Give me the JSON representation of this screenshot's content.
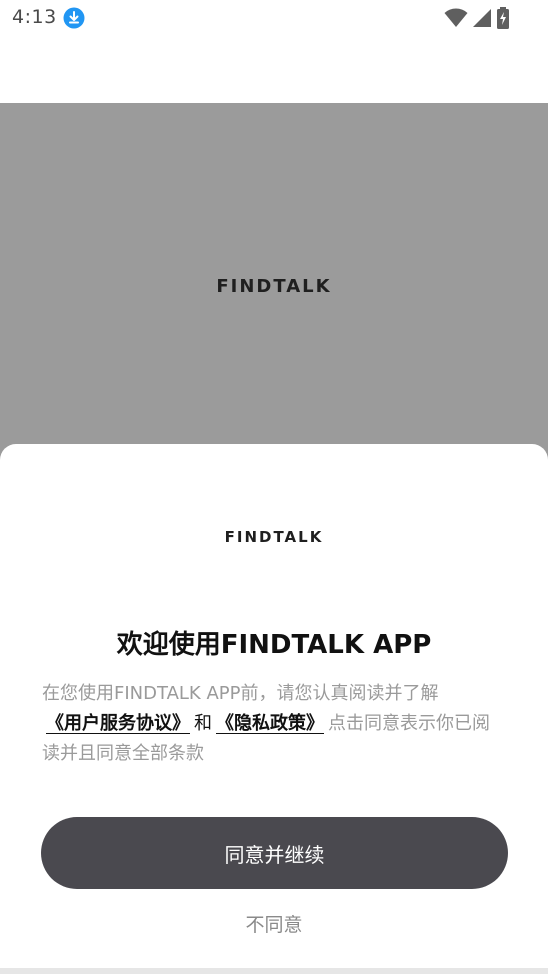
{
  "status_bar": {
    "time": "4:13",
    "download_icon": "download-circle-icon",
    "accent_color": "#2196f3"
  },
  "splash": {
    "logo_text": "FINDTALK",
    "background_color": "#9b9b9b"
  },
  "sheet": {
    "logo_text": "FINDTALK",
    "title": "欢迎使用FINDTALK APP",
    "description": {
      "part1": "在您使用FINDTALK APP前，请您认真阅读并了解",
      "user_agreement": "《用户服务协议》",
      "conjunction": "和",
      "privacy_policy": "《隐私政策》",
      "part2": "点击同意表示你已阅读并且同意全部条款"
    },
    "agree_label": "同意并继续",
    "decline_label": "不同意",
    "button_color": "#4a494f"
  }
}
